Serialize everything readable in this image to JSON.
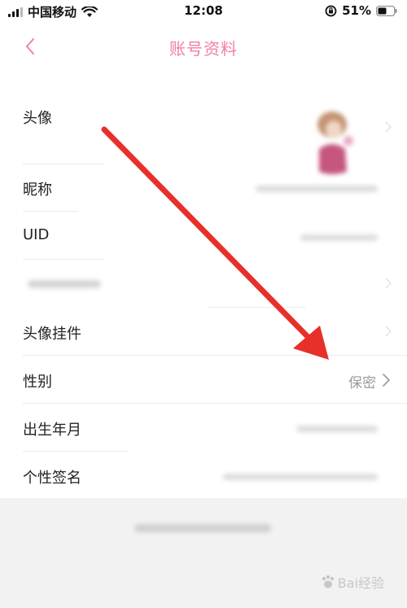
{
  "status_bar": {
    "carrier": "中国移动",
    "time": "12:08",
    "battery": "51%"
  },
  "nav": {
    "title": "账号资料",
    "back_icon": "chevron-left-icon"
  },
  "rows": [
    {
      "key": "avatar",
      "label": "头像"
    },
    {
      "key": "nickname",
      "label": "昵称"
    },
    {
      "key": "uid",
      "label": "UID"
    },
    {
      "key": "blurred",
      "label": ""
    },
    {
      "key": "avatar_pendant",
      "label": "头像挂件"
    },
    {
      "key": "gender",
      "label": "性别",
      "value": "保密"
    },
    {
      "key": "birthday",
      "label": "出生年月"
    },
    {
      "key": "signature",
      "label": "个性签名"
    }
  ],
  "watermark": "Bai经验",
  "colors": {
    "accent": "#f07fa3",
    "arrow": "#e8302a"
  }
}
